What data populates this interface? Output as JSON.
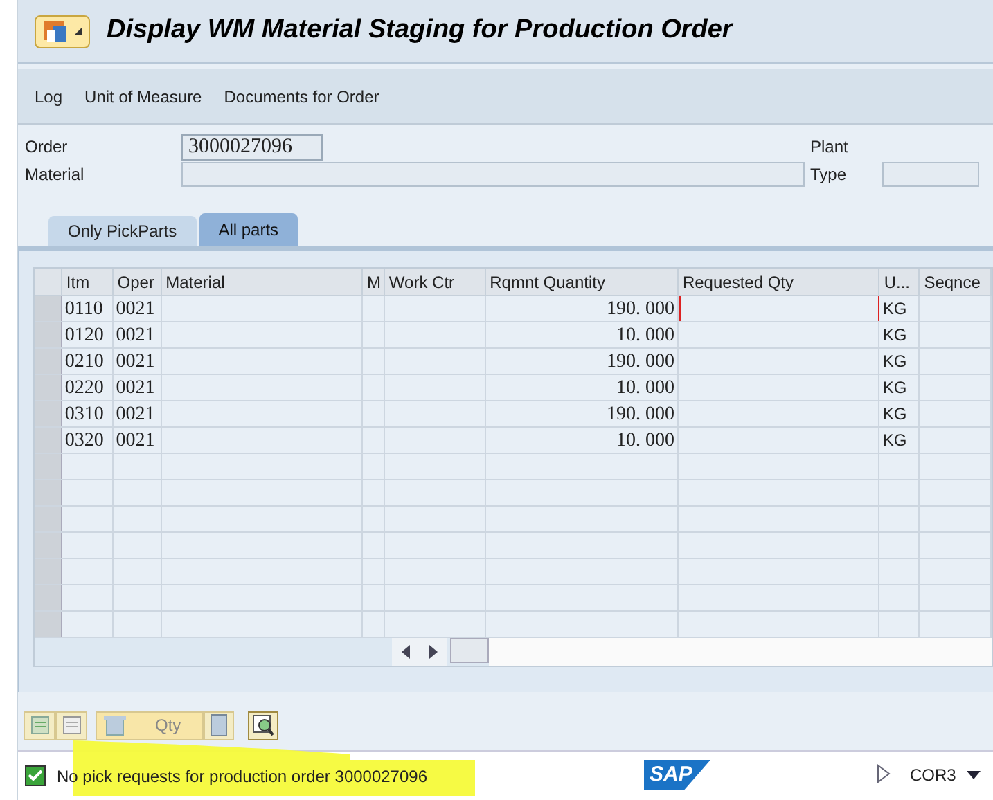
{
  "window": {
    "title": "Display WM Material Staging for Production Order"
  },
  "menu": [
    "Log",
    "Unit of Measure",
    "Documents for Order"
  ],
  "header": {
    "order_label": "Order",
    "order": "3000027096",
    "material_label": "Material",
    "plant_label": "Plant",
    "type_label": "Type"
  },
  "tabs": [
    {
      "label": "Only PickParts",
      "selected": false
    },
    {
      "label": "All parts",
      "selected": true
    }
  ],
  "table": {
    "columns": [
      "Itm",
      "Oper",
      "Material",
      "M",
      "Work Ctr",
      "Rqmnt Quantity",
      "Requested Qty",
      "U...",
      "Seqnce"
    ],
    "rows": [
      {
        "itm": "0110",
        "oper": "0021",
        "rqmnt": "190. 000",
        "uom": "KG",
        "focused": true
      },
      {
        "itm": "0120",
        "oper": "0021",
        "rqmnt": "10. 000",
        "uom": "KG",
        "focused": false
      },
      {
        "itm": "0210",
        "oper": "0021",
        "rqmnt": "190. 000",
        "uom": "KG",
        "focused": false
      },
      {
        "itm": "0220",
        "oper": "0021",
        "rqmnt": "10. 000",
        "uom": "KG",
        "focused": false
      },
      {
        "itm": "0310",
        "oper": "0021",
        "rqmnt": "190. 000",
        "uom": "KG",
        "focused": false
      },
      {
        "itm": "0320",
        "oper": "0021",
        "rqmnt": "10. 000",
        "uom": "KG",
        "focused": false
      }
    ]
  },
  "toolbar": {
    "qty_button": "Qty"
  },
  "status_bar": {
    "kind": "success",
    "message": "No pick requests for production order 3000027096",
    "logo": "SAP",
    "system": "COR3"
  }
}
